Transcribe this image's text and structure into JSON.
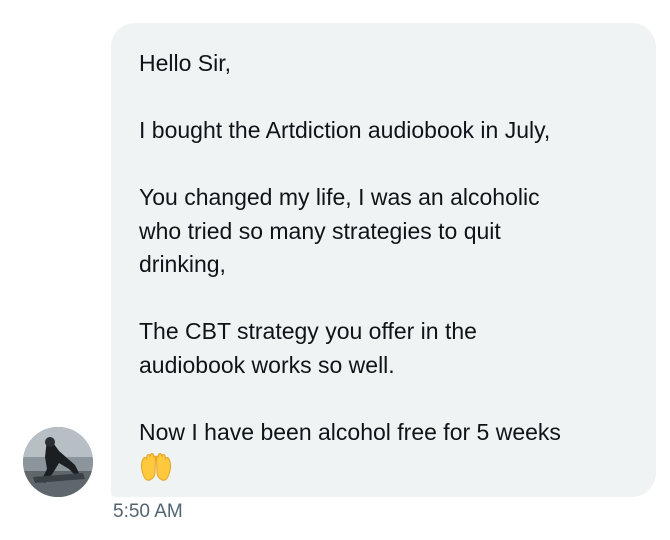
{
  "message": {
    "paragraphs": [
      "Hello Sir,",
      "I bought the Artdiction audiobook in July,",
      "You changed my life, I was an alcoholic\nwho tried so many strategies to quit\ndrinking,",
      "The CBT strategy you offer in the\naudiobook works so well.",
      "Now I have been alcohol free for 5 weeks"
    ],
    "emoji": "open-hands-icon",
    "timestamp": "5:50 AM"
  },
  "colors": {
    "bubble": "#eff3f4",
    "text": "#0f1419",
    "timestamp": "#536471",
    "emoji": "#ffc83d"
  }
}
